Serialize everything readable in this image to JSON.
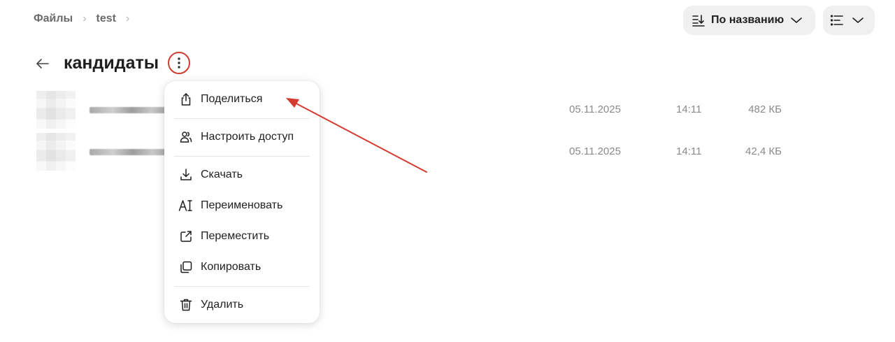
{
  "breadcrumb": {
    "root": "Файлы",
    "current": "test"
  },
  "toolbar": {
    "sort_label": "По названию"
  },
  "folder": {
    "title": "кандидаты"
  },
  "files": [
    {
      "date": "05.11.2025",
      "time": "14:11",
      "size": "482 КБ"
    },
    {
      "date": "05.11.2025",
      "time": "14:11",
      "size": "42,4 КБ"
    }
  ],
  "menu": {
    "share": "Поделиться",
    "access": "Настроить доступ",
    "download": "Скачать",
    "rename": "Переименовать",
    "move": "Переместить",
    "copy": "Копировать",
    "delete": "Удалить"
  },
  "colors": {
    "highlight": "#d33a30",
    "control_bg": "#f0f0f0"
  },
  "icons": [
    "share-icon",
    "people-icon",
    "download-icon",
    "rename-icon",
    "move-icon",
    "copy-icon",
    "trash-icon",
    "sort-icon",
    "list-view-icon",
    "chevron-down-icon",
    "back-arrow-icon",
    "more-vertical-icon"
  ]
}
